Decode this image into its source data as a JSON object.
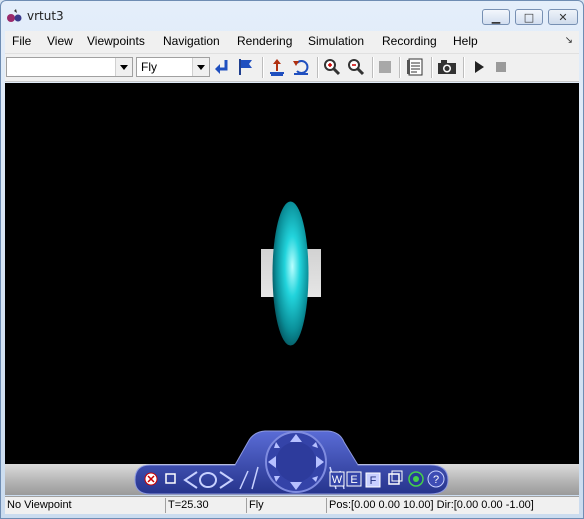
{
  "window": {
    "title": "vrtut3"
  },
  "menu": [
    "File",
    "View",
    "Viewpoints",
    "Navigation",
    "Rendering",
    "Simulation",
    "Recording",
    "Help"
  ],
  "toolbar": {
    "viewpoint_value": "",
    "nav_mode_value": "Fly"
  },
  "nav_panel": {
    "w_label": "W",
    "e_label": "E",
    "f_label": "F",
    "help_label": "?"
  },
  "status": {
    "viewpoint": "No Viewpoint",
    "time": "T=25.30",
    "mode": "Fly",
    "pos_dir": "Pos:[0.00 0.00 10.00] Dir:[0.00 0.00 -1.00]"
  },
  "colors": {
    "scene_bg": "#000000",
    "ellipsoid": "#00c8d4",
    "nav_panel": "#3344a8"
  }
}
